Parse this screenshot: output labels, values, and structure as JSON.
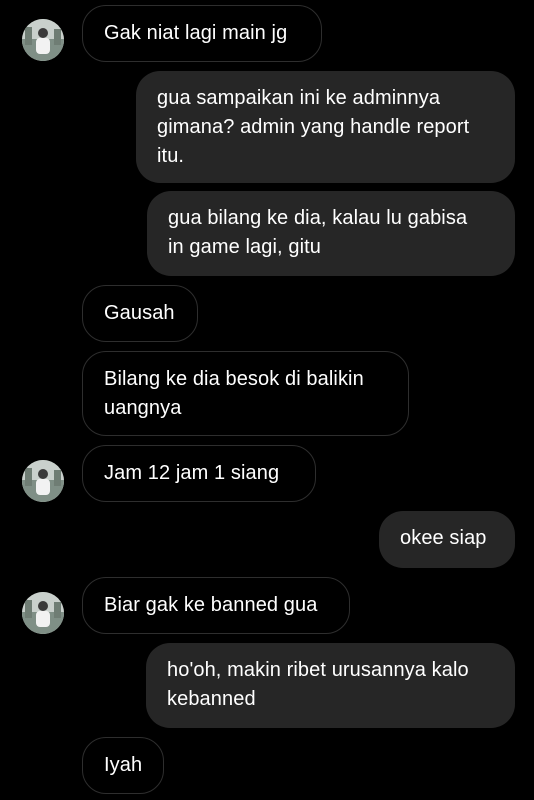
{
  "messages": [
    {
      "sender": "them",
      "text": "Gak niat lagi main jg"
    },
    {
      "sender": "me",
      "text": "gua sampaikan ini ke adminnya\ngimana? admin yang handle report\nitu."
    },
    {
      "sender": "me",
      "text": "gua bilang ke dia, kalau lu gabisa\nin game lagi, gitu"
    },
    {
      "sender": "them",
      "text": "Gausah"
    },
    {
      "sender": "them",
      "text": "Bilang ke dia besok di balikin\nuangnya"
    },
    {
      "sender": "them",
      "text": "Jam 12 jam 1 siang"
    },
    {
      "sender": "me",
      "text": "okee siap"
    },
    {
      "sender": "them",
      "text": "Biar gak ke banned gua"
    },
    {
      "sender": "me",
      "text": "ho'oh, makin ribet urusannya kalo\nkebanned"
    },
    {
      "sender": "them",
      "text": "Iyah"
    }
  ],
  "colors": {
    "background": "#000000",
    "incoming_border": "#2e2e2e",
    "outgoing_bubble": "#262626",
    "text": "#ffffff"
  },
  "icons": {
    "avatar": "contact-avatar-photo"
  }
}
